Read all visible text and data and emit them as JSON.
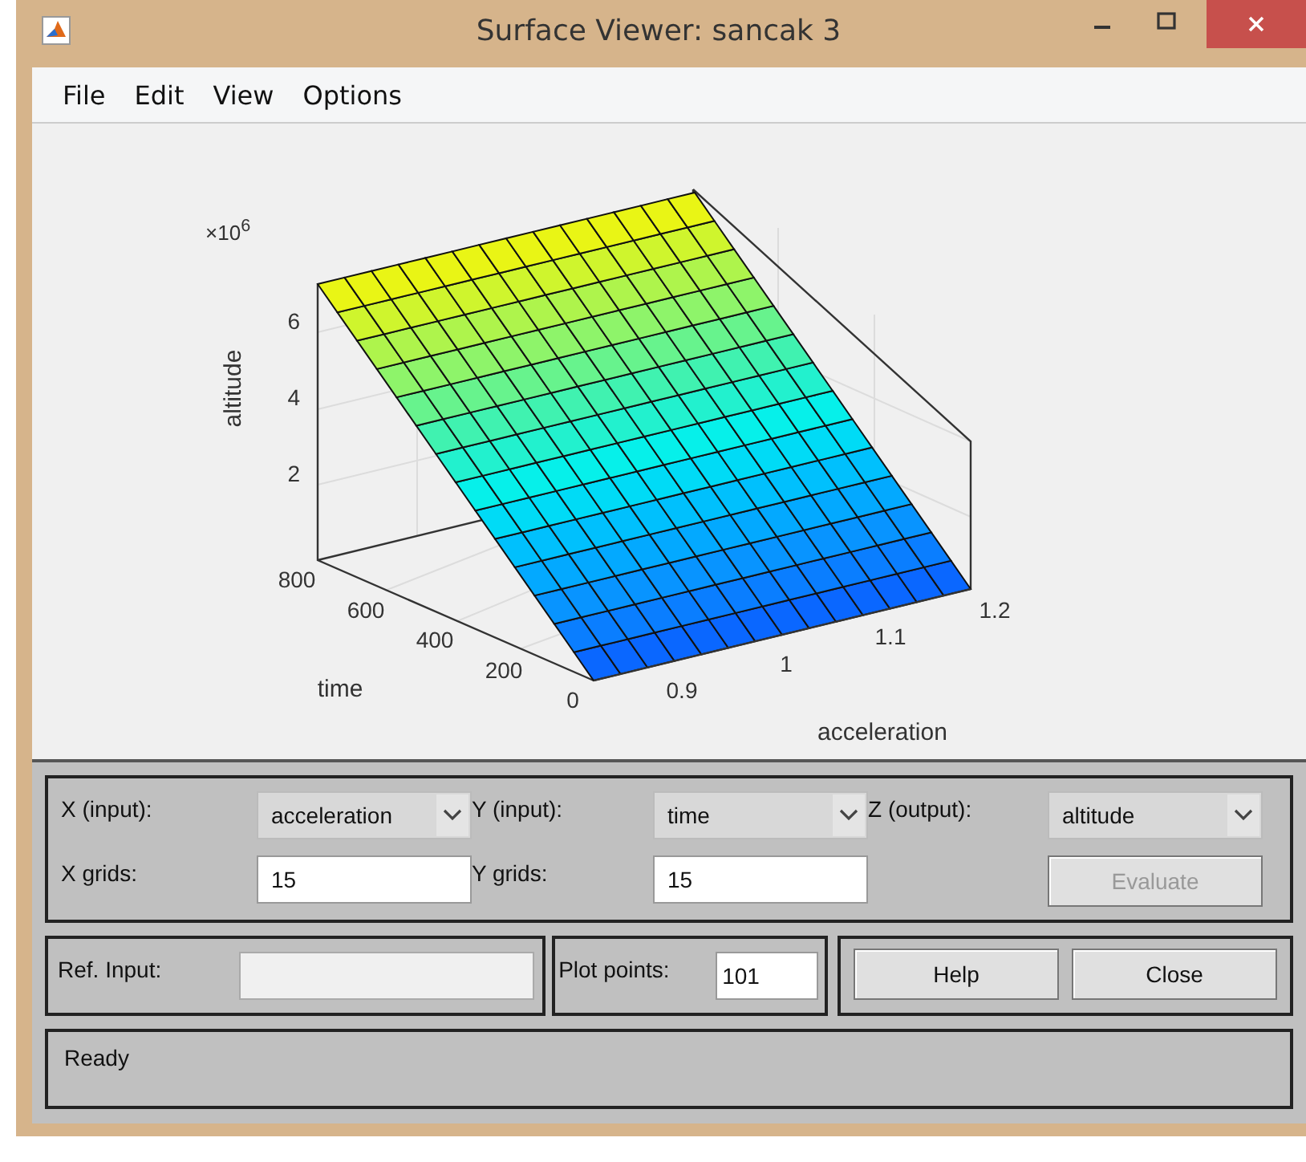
{
  "window": {
    "title": "Surface Viewer: sancak 3"
  },
  "menu": [
    "File",
    "Edit",
    "View",
    "Options"
  ],
  "plot": {
    "z_multiplier": "×10$^{6}$",
    "z_label": "altitude",
    "z_ticks": [
      "6",
      "4",
      "2"
    ],
    "y_label": "time",
    "y_ticks": [
      "0",
      "200",
      "400",
      "600",
      "800"
    ],
    "x_label": "acceleration",
    "x_ticks": [
      "0.9",
      "1",
      "1.1",
      "1.2"
    ]
  },
  "axes_panel": {
    "x_input": {
      "label": "X (input):",
      "value": "acceleration"
    },
    "y_input": {
      "label": "Y (input):",
      "value": "time"
    },
    "z_output": {
      "label": "Z (output):",
      "value": "altitude"
    },
    "x_grids": {
      "label": "X grids:",
      "value": "15"
    },
    "y_grids": {
      "label": "Y grids:",
      "value": "15"
    },
    "evaluate": {
      "label": "Evaluate",
      "disabled": true
    }
  },
  "ref_input": {
    "label": "Ref. Input:",
    "disabled": true
  },
  "plot_points": {
    "label": "Plot points:",
    "value": "101"
  },
  "buttons": [
    {
      "label": "Help"
    },
    {
      "label": "Close"
    }
  ],
  "status": "Ready"
}
